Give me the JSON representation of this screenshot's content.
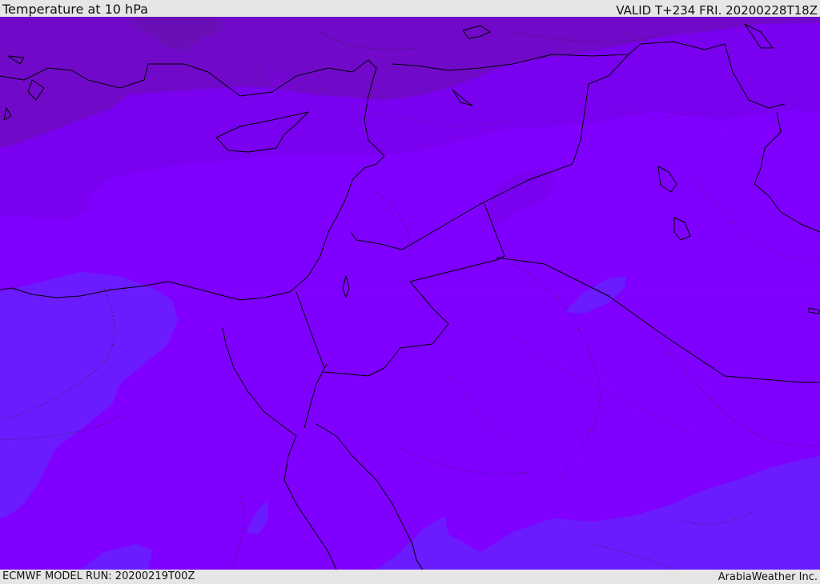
{
  "header": {
    "title": "Temperature at 10 hPa",
    "valid": "VALID T+234 FRI. 20200228T18Z"
  },
  "footer": {
    "model_run": "ECMWF MODEL RUN: 20200219T00Z",
    "credit": "ArabiaWeather Inc."
  },
  "map": {
    "field": "temperature",
    "pressure_level": "10 hPa",
    "colors": {
      "band_coldest": "#6a0fb8",
      "band_cold": "#7009c8",
      "band_mid": "#7a00f0",
      "band_main": "#7f00ff",
      "band_warm": "#6a1cff",
      "band_warmest": "#5e22ff",
      "coastline": "#000000"
    }
  }
}
